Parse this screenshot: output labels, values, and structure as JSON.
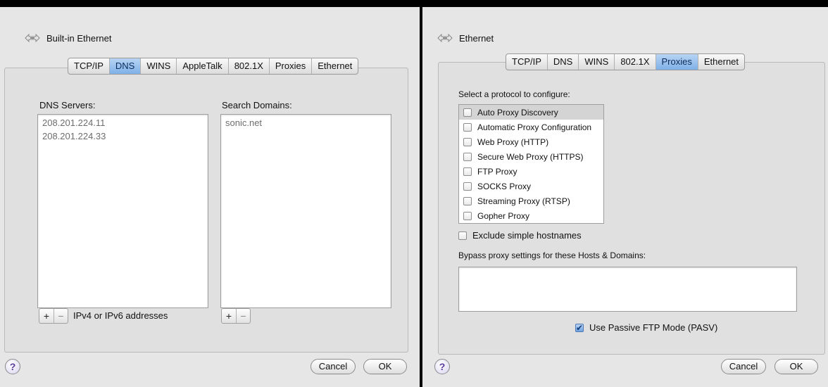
{
  "left": {
    "title": "Built-in Ethernet",
    "tabs": [
      "TCP/IP",
      "DNS",
      "WINS",
      "AppleTalk",
      "802.1X",
      "Proxies",
      "Ethernet"
    ],
    "active_tab": "DNS",
    "dns_servers_label": "DNS Servers:",
    "dns_servers": [
      "208.201.224.11",
      "208.201.224.33"
    ],
    "search_domains_label": "Search Domains:",
    "search_domains": [
      "sonic.net"
    ],
    "plus": "+",
    "minus": "−",
    "addresses_hint": "IPv4 or IPv6 addresses",
    "help": "?",
    "cancel": "Cancel",
    "ok": "OK"
  },
  "right": {
    "title": "Ethernet",
    "tabs": [
      "TCP/IP",
      "DNS",
      "WINS",
      "802.1X",
      "Proxies",
      "Ethernet"
    ],
    "active_tab": "Proxies",
    "protocol_label": "Select a protocol to configure:",
    "protocols": [
      {
        "label": "Auto Proxy Discovery",
        "checked": false,
        "selected": true
      },
      {
        "label": "Automatic Proxy Configuration",
        "checked": false,
        "selected": false
      },
      {
        "label": "Web Proxy (HTTP)",
        "checked": false,
        "selected": false
      },
      {
        "label": "Secure Web Proxy (HTTPS)",
        "checked": false,
        "selected": false
      },
      {
        "label": "FTP Proxy",
        "checked": false,
        "selected": false
      },
      {
        "label": "SOCKS Proxy",
        "checked": false,
        "selected": false
      },
      {
        "label": "Streaming Proxy (RTSP)",
        "checked": false,
        "selected": false
      },
      {
        "label": "Gopher Proxy",
        "checked": false,
        "selected": false
      }
    ],
    "exclude_simple_hostnames": {
      "label": "Exclude simple hostnames",
      "checked": false
    },
    "bypass_label": "Bypass proxy settings for these Hosts & Domains:",
    "bypass_value": "",
    "passive_ftp": {
      "label": "Use Passive FTP Mode (PASV)",
      "checked": true
    },
    "help": "?",
    "cancel": "Cancel",
    "ok": "OK"
  },
  "icons": {
    "network": "ethernet-arrows-icon",
    "help": "help-icon",
    "checkmark": "✔"
  },
  "colors": {
    "tab_active": "#7fb1e8",
    "dialog_bg": "#e6e6e6",
    "frame": "#000000"
  }
}
